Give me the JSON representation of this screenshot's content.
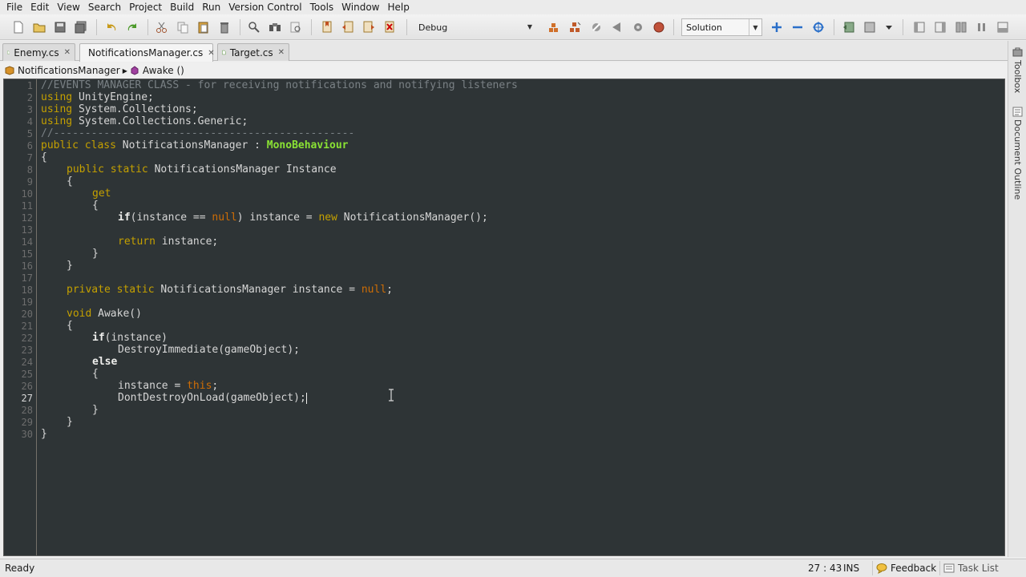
{
  "menu": [
    "File",
    "Edit",
    "View",
    "Search",
    "Project",
    "Build",
    "Run",
    "Version Control",
    "Tools",
    "Window",
    "Help"
  ],
  "toolbar": {
    "config_label": "Debug",
    "solution_label": "Solution"
  },
  "tabs": [
    {
      "label": "Enemy.cs",
      "active": false
    },
    {
      "label": "NotificationsManager.cs",
      "active": true
    },
    {
      "label": "Target.cs",
      "active": false
    }
  ],
  "breadcrumb": {
    "class_name": "NotificationsManager",
    "member_name": "Awake ()"
  },
  "editor": {
    "current_line": 27,
    "lines": [
      "1",
      "2",
      "3",
      "4",
      "5",
      "6",
      "7",
      "8",
      "9",
      "10",
      "11",
      "12",
      "13",
      "14",
      "15",
      "16",
      "17",
      "18",
      "19",
      "20",
      "21",
      "22",
      "23",
      "24",
      "25",
      "26",
      "27",
      "28",
      "29",
      "30"
    ],
    "code": {
      "l1": "//EVENTS MANAGER CLASS - for receiving notifications and notifying listeners",
      "l2_kw": "using",
      "l2_rest": " UnityEngine;",
      "l3_kw": "using",
      "l3_rest": " System.Collections;",
      "l4_kw": "using",
      "l4_rest": " System.Collections.Generic;",
      "l5": "//------------------------------------------------",
      "l6_kw": "public class",
      "l6_mid": " NotificationsManager : ",
      "l6_type": "MonoBehaviour",
      "l7": "{",
      "l8_kw": "public static",
      "l8_rest": " NotificationsManager Instance",
      "l9": "{",
      "l10_kw": "get",
      "l11": "{",
      "l12_kw": "if",
      "l12_a": "(instance == ",
      "l12_null": "null",
      "l12_b": ") instance = ",
      "l12_new": "new",
      "l12_c": " NotificationsManager();",
      "l14_kw": "return",
      "l14_rest": " instance;",
      "l15": "}",
      "l16": "}",
      "l18_kw": "private static",
      "l18_mid": " NotificationsManager instance = ",
      "l18_null": "null",
      "l18_end": ";",
      "l20_kw": "void",
      "l20_rest": " Awake()",
      "l21": "{",
      "l22_kw": "if",
      "l22_rest": "(instance)",
      "l23": "DestroyImmediate(gameObject);",
      "l24_kw": "else",
      "l25": "{",
      "l26_a": "instance = ",
      "l26_this": "this",
      "l26_b": ";",
      "l27": "DontDestroyOnLoad(gameObject);",
      "l28": "}",
      "l29": "}",
      "l30": "}"
    }
  },
  "right_dock": {
    "toolbox": "Toolbox",
    "outline": "Document Outline"
  },
  "status": {
    "text": "Ready",
    "position": "27 : 43",
    "mode": "INS",
    "feedback": "Feedback",
    "tasklist": "Task List"
  }
}
